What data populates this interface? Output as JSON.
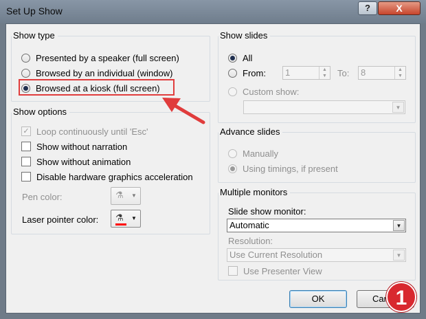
{
  "window": {
    "title": "Set Up Show",
    "help_label": "?",
    "close_label": "X"
  },
  "show_type": {
    "legend": "Show type",
    "options": [
      {
        "label": "Presented by a speaker (full screen)",
        "checked": false
      },
      {
        "label": "Browsed by an individual (window)",
        "checked": false
      },
      {
        "label": "Browsed at a kiosk (full screen)",
        "checked": true
      }
    ]
  },
  "show_options": {
    "legend": "Show options",
    "loop_label": "Loop continuously until 'Esc'",
    "without_narration_label": "Show without narration",
    "without_animation_label": "Show without animation",
    "disable_hw_label": "Disable hardware graphics acceleration",
    "pen_color_label": "Pen color:",
    "laser_pointer_label": "Laser pointer color:",
    "laser_color": "#ff0000"
  },
  "show_slides": {
    "legend": "Show slides",
    "all_label": "All",
    "from_label": "From:",
    "from_value": "1",
    "to_label": "To:",
    "to_value": "8",
    "custom_show_label": "Custom show:",
    "custom_show_value": ""
  },
  "advance_slides": {
    "legend": "Advance slides",
    "manually_label": "Manually",
    "timings_label": "Using timings, if present"
  },
  "multiple_monitors": {
    "legend": "Multiple monitors",
    "monitor_label": "Slide show monitor:",
    "monitor_value": "Automatic",
    "resolution_label": "Resolution:",
    "resolution_value": "Use Current Resolution",
    "presenter_view_label": "Use Presenter View"
  },
  "buttons": {
    "ok_label": "OK",
    "cancel_label": "Can"
  },
  "annotation": {
    "badge_number": "1",
    "highlight_color": "#e03c3c"
  }
}
